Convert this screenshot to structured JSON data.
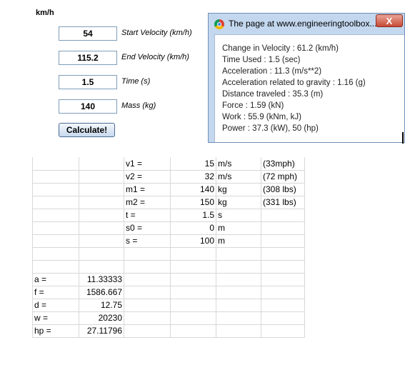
{
  "header": {
    "unit_label": "km/h"
  },
  "calculator": {
    "fields": [
      {
        "value": "54",
        "label": "Start Velocity (km/h)"
      },
      {
        "value": "115.2",
        "label": "End Velocity (km/h)"
      },
      {
        "value": "1.5",
        "label": "Time (s)"
      },
      {
        "value": "140",
        "label": "Mass (kg)"
      }
    ],
    "button_label": "Calculate!"
  },
  "dialog": {
    "title": "The page at www.engineeringtoolbox....",
    "close_label": "X",
    "lines": [
      "Change in Velocity : 61.2 (km/h)",
      "Time Used : 1.5 (sec)",
      "Acceleration : 11.3 (m/s**2)",
      "Acceleration related to gravity : 1.16 (g)",
      "Distance traveled : 35.3 (m)",
      "Force : 1.59 (kN)",
      "Work : 55.9 (kNm, kJ)",
      "Power : 37.3 (kW), 50 (hp)"
    ]
  },
  "sheet": {
    "rows": [
      [
        "",
        "",
        "v1 =",
        "15",
        "m/s",
        "(33mph)"
      ],
      [
        "",
        "",
        "v2 =",
        "32",
        "m/s",
        "(72 mph)"
      ],
      [
        "",
        "",
        "m1 =",
        "140",
        "kg",
        "(308 lbs)"
      ],
      [
        "",
        "",
        "m2 =",
        "150",
        "kg",
        "(331 lbs)"
      ],
      [
        "",
        "",
        "t =",
        "1.5",
        "s",
        ""
      ],
      [
        "",
        "",
        "s0 =",
        "0",
        "m",
        ""
      ],
      [
        "",
        "",
        "s =",
        "100",
        "m",
        ""
      ],
      [
        "",
        "",
        "",
        "",
        "",
        ""
      ],
      [
        "",
        "",
        "",
        "",
        "",
        ""
      ],
      [
        "a =",
        "11.33333",
        "",
        "",
        "",
        ""
      ],
      [
        "f =",
        "1586.667",
        "",
        "",
        "",
        ""
      ],
      [
        "d =",
        "12.75",
        "",
        "",
        "",
        ""
      ],
      [
        "w =",
        "20230",
        "",
        "",
        "",
        ""
      ],
      [
        "hp =",
        "27.11796",
        "",
        "",
        "",
        ""
      ]
    ]
  }
}
